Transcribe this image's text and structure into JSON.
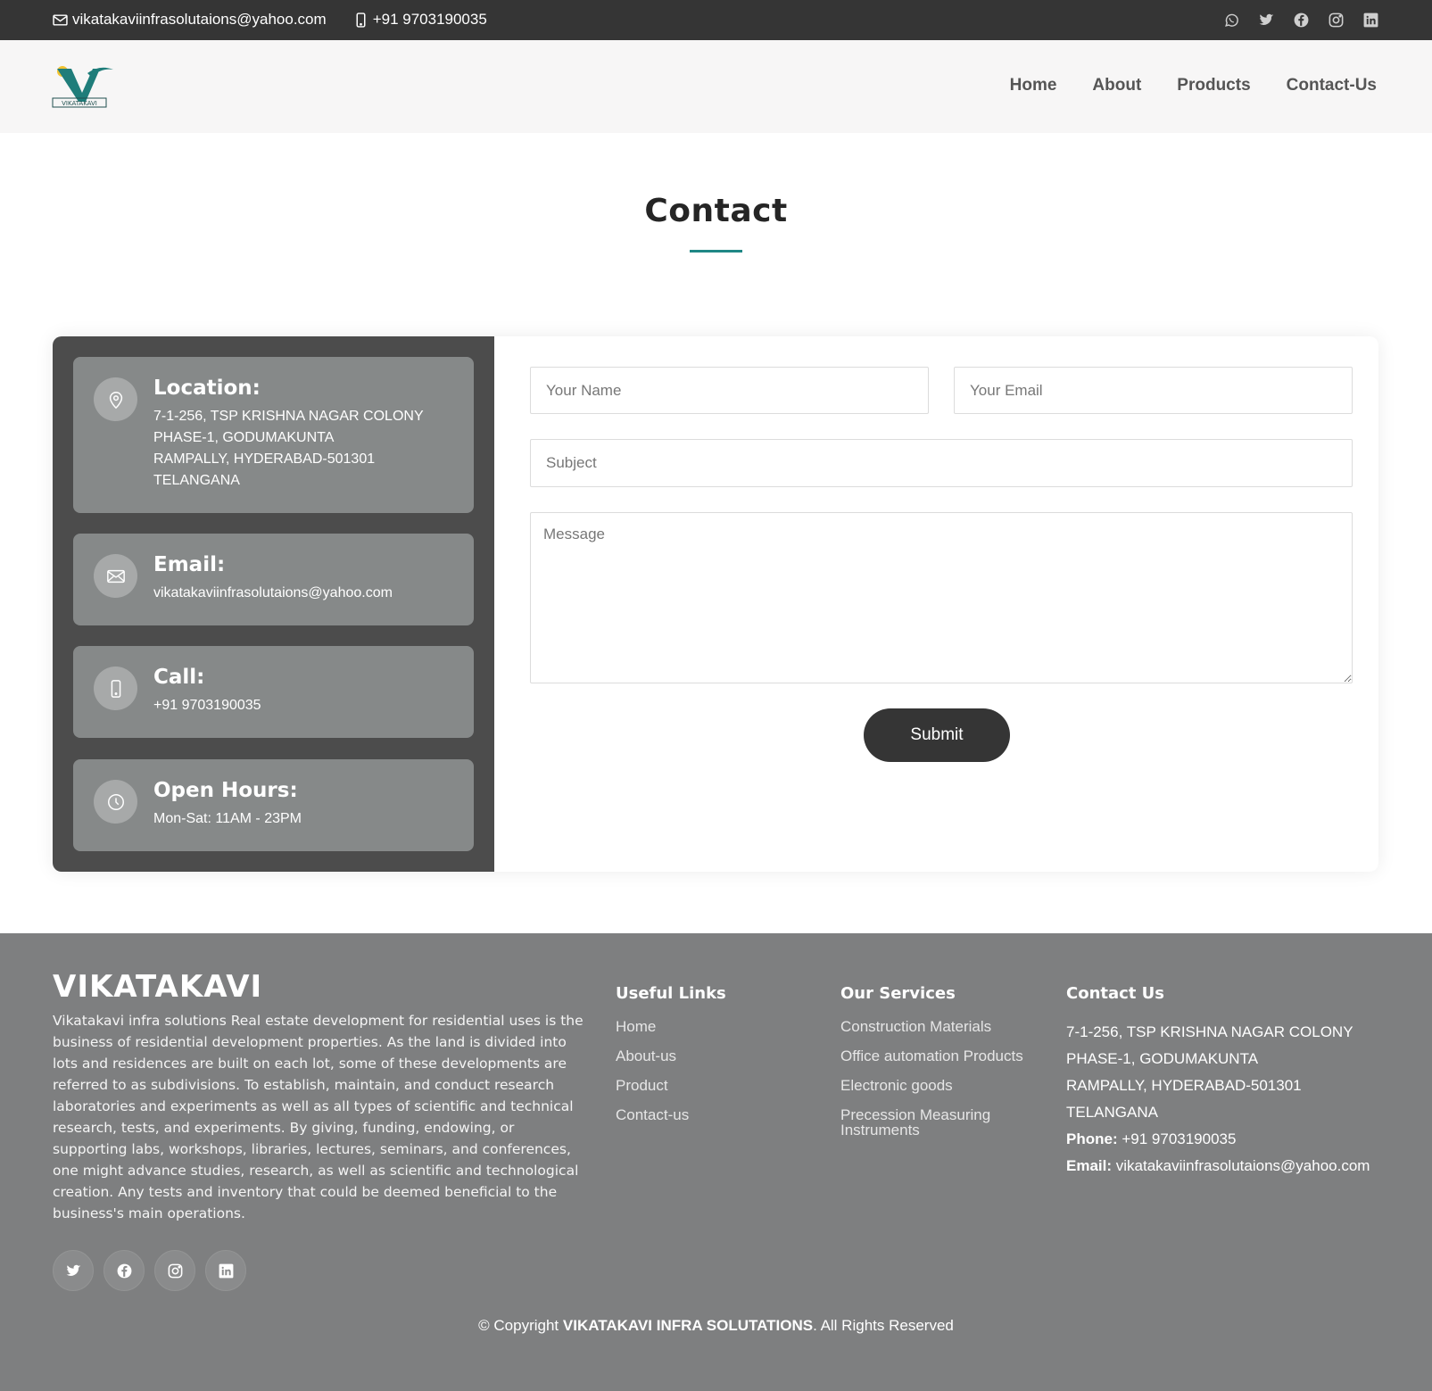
{
  "topbar": {
    "email": "vikatakaviinfrasolutaions@yahoo.com",
    "phone": "+91 9703190035",
    "socials": [
      "whatsapp-icon",
      "twitter-icon",
      "facebook-icon",
      "instagram-icon",
      "linkedin-icon"
    ]
  },
  "header": {
    "logo_text": "VIKATAKAVI",
    "nav": [
      "Home",
      "About",
      "Products",
      "Contact-Us"
    ]
  },
  "page": {
    "title": "Contact"
  },
  "info": {
    "location": {
      "title": "Location:",
      "text": "7-1-256, TSP KRISHNA NAGAR COLONY\nPHASE-1, GODUMAKUNTA\nRAMPALLY, HYDERABAD-501301\nTELANGANA"
    },
    "email": {
      "title": "Email:",
      "text": "vikatakaviinfrasolutaions@yahoo.com"
    },
    "call": {
      "title": "Call:",
      "text": "+91 9703190035"
    },
    "hours": {
      "title": "Open Hours:",
      "text": "Mon-Sat: 11AM - 23PM"
    }
  },
  "form": {
    "name_placeholder": "Your Name",
    "email_placeholder": "Your Email",
    "subject_placeholder": "Subject",
    "message_placeholder": "Message",
    "submit_label": "Submit"
  },
  "footer": {
    "brand": "VIKATAKAVI",
    "about": "Vikatakavi infra solutions Real estate development for residential uses is the business of residential development properties. As the land is divided into lots and residences are built on each lot, some of these developments are referred to as subdivisions. To establish, maintain, and conduct research laboratories and experiments as well as all types of scientific and technical research, tests, and experiments. By giving, funding, endowing, or supporting labs, workshops, libraries, lectures, seminars, and conferences, one might advance studies, research, as well as scientific and technological creation. Any tests and inventory that could be deemed beneficial to the business's main operations.",
    "socials": [
      "twitter-icon",
      "facebook-icon",
      "instagram-icon",
      "linkedin-icon"
    ],
    "useful_links": {
      "title": "Useful Links",
      "items": [
        "Home",
        "About-us",
        "Product",
        "Contact-us"
      ]
    },
    "services": {
      "title": "Our Services",
      "items": [
        "Construction Materials",
        "Office automation Products",
        "Electronic goods",
        "Precession Measuring Instruments"
      ]
    },
    "contact": {
      "title": "Contact Us",
      "address": [
        "7-1-256, TSP KRISHNA NAGAR COLONY",
        "PHASE-1, GODUMAKUNTA",
        "RAMPALLY, HYDERABAD-501301",
        "TELANGANA"
      ],
      "phone_label": "Phone:",
      "phone": "+91 9703190035",
      "email_label": "Email:",
      "email": "vikatakaviinfrasolutaions@yahoo.com"
    },
    "copyright_prefix": "© Copyright",
    "copyright_company": "VIKATAKAVI INFRA SOLUTATIONS",
    "copyright_suffix": ". All Rights Reserved"
  },
  "colors": {
    "topbar": "#353535",
    "accent": "#1f8785",
    "info_panel": "#4c4c4c",
    "info_box": "#868989",
    "footer": "#7e7f80",
    "button": "#353535"
  }
}
